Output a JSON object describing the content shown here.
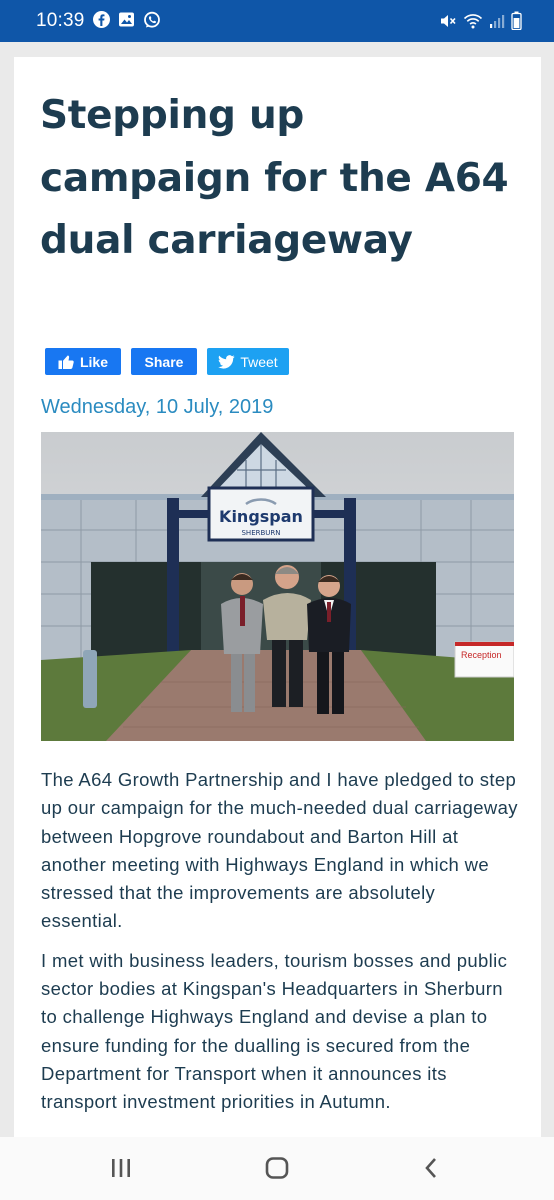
{
  "status_bar": {
    "time": "10:39",
    "left_icons": [
      "facebook-icon",
      "gallery-icon",
      "whatsapp-icon"
    ],
    "right_icons": [
      "mute-icon",
      "wifi-icon",
      "signal-icon",
      "battery-icon"
    ],
    "background_color": "#0f56a8"
  },
  "article": {
    "title": "Stepping up campaign for the A64 dual carriageway",
    "social": {
      "like_label": "Like",
      "share_label": "Share",
      "tweet_label": "Tweet"
    },
    "date": "Wednesday, 10 July, 2019",
    "photo": {
      "sign_brand": "Kingspan",
      "sign_location": "SHERBURN",
      "reception_sign": "Reception"
    },
    "paragraphs": [
      "The A64 Growth Partnership and I have pledged to step up our campaign for the much-needed dual carriageway between Hopgrove roundabout and Barton Hill at another meeting with Highways England in which we stressed that the improvements are absolutely essential.",
      "I met with business leaders, tourism bosses and public sector bodies at Kingspan's Headquarters in Sherburn to challenge Highways England and devise a plan to ensure funding for the dualling is secured from the Department for Transport when it announces its transport investment priorities in Autumn."
    ],
    "colors": {
      "title": "#1d3c50",
      "date": "#2a8bc0",
      "facebook": "#1877f2",
      "twitter": "#1da1f2"
    }
  },
  "nav_bar": {
    "buttons": [
      "recent-apps-icon",
      "home-icon",
      "back-icon"
    ]
  }
}
